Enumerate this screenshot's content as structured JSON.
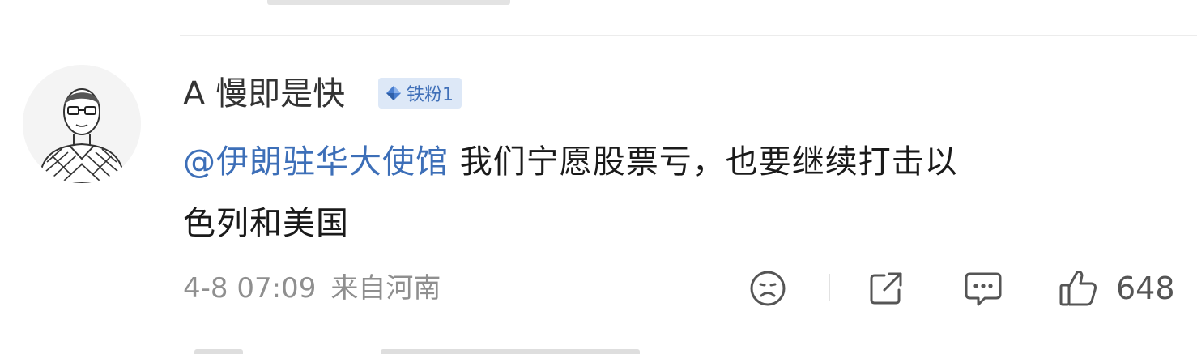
{
  "comment": {
    "username": "A 慢即是快",
    "badge": {
      "text": "铁粉1",
      "icon": "diamond-icon",
      "color": "#3f6fb8",
      "background": "#dde8f7"
    },
    "mention": "@伊朗驻华大使馆",
    "body_line1": " 我们宁愿股票亏，也要继续打击以",
    "body_line2": "色列和美国",
    "timestamp": "4-8 07:09",
    "location": "来自河南",
    "like_count": "648"
  },
  "icons": {
    "avatar": "avatar-sketch",
    "dislike": "sad-face-icon",
    "share": "share-icon",
    "reply": "comment-icon",
    "like": "thumbs-up-icon"
  },
  "colors": {
    "mention": "#3d6fb8",
    "text": "#1a1a1a",
    "meta": "#8f8f8f",
    "divider": "#ececec"
  }
}
